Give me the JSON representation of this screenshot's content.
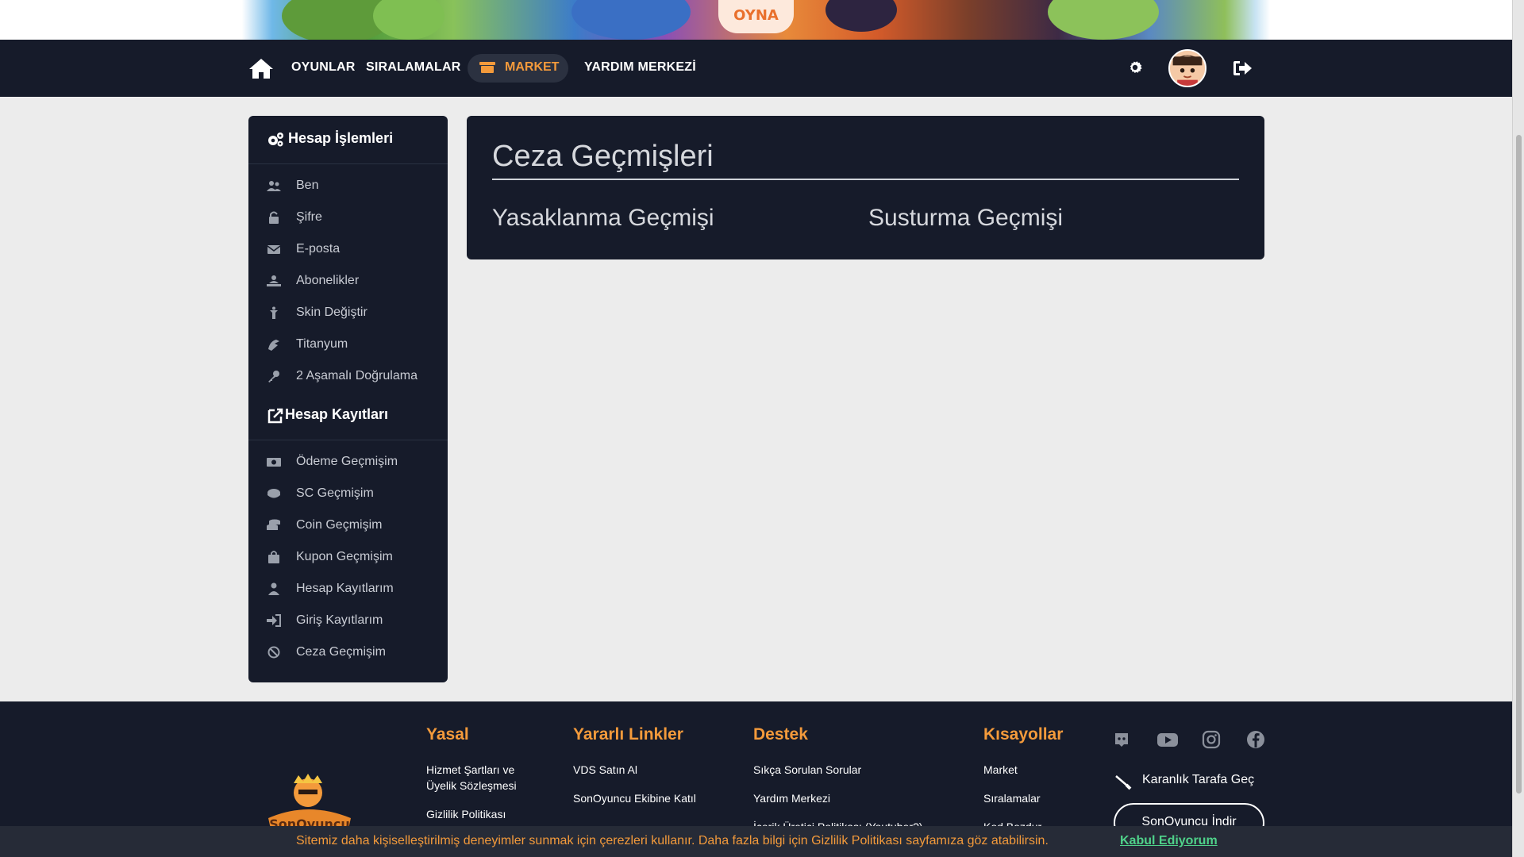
{
  "banner": {
    "play_label": "OYNA"
  },
  "nav": {
    "links": [
      "OYUNLAR",
      "SIRALAMALAR",
      "YARDIM MERKEZİ"
    ],
    "market_label": "MARKET"
  },
  "sidebar": {
    "section1_title": "Hesap İşlemleri",
    "section1_items": [
      {
        "label": "Ben",
        "icon": "users-icon"
      },
      {
        "label": "Şifre",
        "icon": "lock-icon"
      },
      {
        "label": "E-posta",
        "icon": "envelope-icon"
      },
      {
        "label": "Abonelikler",
        "icon": "subscription-icon"
      },
      {
        "label": "Skin Değiştir",
        "icon": "skin-icon"
      },
      {
        "label": "Titanyum",
        "icon": "titanium-icon"
      },
      {
        "label": "2 Aşamalı Doğrulama",
        "icon": "key-icon"
      }
    ],
    "section2_title": "Hesap Kayıtları",
    "section2_items": [
      {
        "label": "Ödeme Geçmişim",
        "icon": "money-icon"
      },
      {
        "label": "SC Geçmişim",
        "icon": "sc-icon"
      },
      {
        "label": "Coin Geçmişim",
        "icon": "coins-icon"
      },
      {
        "label": "Kupon Geçmişim",
        "icon": "bag-icon"
      },
      {
        "label": "Hesap Kayıtlarım",
        "icon": "user-icon"
      },
      {
        "label": "Giriş Kayıtlarım",
        "icon": "sign-in-icon"
      },
      {
        "label": "Ceza Geçmişim",
        "icon": "ban-icon"
      }
    ]
  },
  "main": {
    "title": "Ceza Geçmişleri",
    "tab_ban": "Yasaklanma Geçmişi",
    "tab_mute": "Susturma Geçmişi"
  },
  "footer": {
    "legal": {
      "title": "Yasal",
      "links": [
        "Hizmet Şartları ve Üyelik Sözleşmesi",
        "Gizlilik Politikası"
      ]
    },
    "useful": {
      "title": "Yararlı Linkler",
      "links": [
        "VDS Satın Al",
        "SonOyuncu Ekibine Katıl"
      ]
    },
    "support": {
      "title": "Destek",
      "links": [
        "Sıkça Sorulan Sorular",
        "Yardım Merkezi",
        "İçerik Üretici Politikası (Youtuber?)"
      ]
    },
    "shortcuts": {
      "title": "Kısayollar",
      "links": [
        "Market",
        "Sıralamalar",
        "Kod Bozdur"
      ]
    },
    "logo_text": "SonOyuncu",
    "dark_mode_label": "Karanlık Tarafa Geç",
    "download_label": "SonOyuncu İndir"
  },
  "cookie": {
    "message": "Sitemiz daha kişiselleştirilmiş deneyimler sunmak için çerezleri kullanır. Daha fazla bilgi için Gizlilik Politikası sayfamıza göz atabilirsin.",
    "accept_label": "Kabul Ediyorum"
  },
  "colors": {
    "accent": "#f39a3b",
    "dark": "#161b2a",
    "accept": "#4fd28a"
  }
}
